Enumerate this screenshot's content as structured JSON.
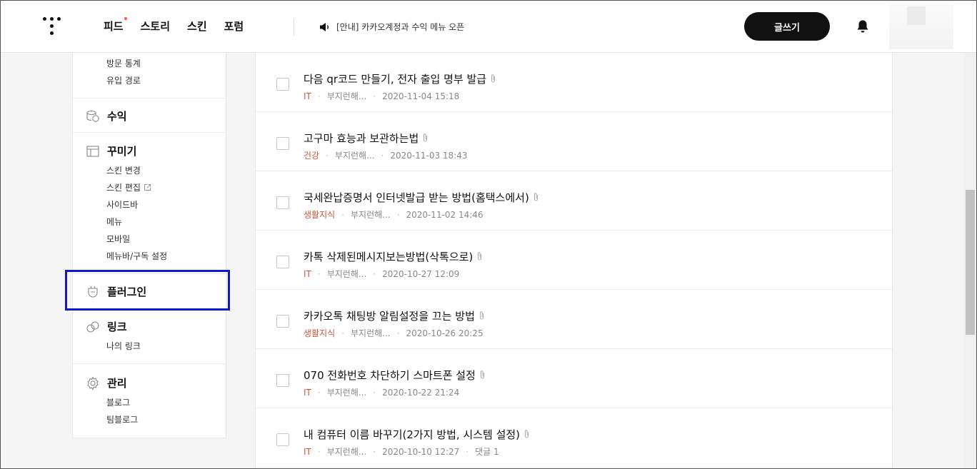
{
  "header": {
    "nav": [
      {
        "label": "피드",
        "new": true
      },
      {
        "label": "스토리",
        "new": false
      },
      {
        "label": "스킨",
        "new": false
      },
      {
        "label": "포럼",
        "new": false
      }
    ],
    "notice": "[안내] 카카오계정과 수익 메뉴 오픈",
    "write_label": "글쓰기"
  },
  "sidebar": {
    "stats_subs": [
      "방문 통계",
      "유입 경로"
    ],
    "revenue": "수익",
    "decorate": {
      "label": "꾸미기",
      "subs": [
        "스킨 변경",
        "스킨 편집",
        "사이드바",
        "메뉴",
        "모바일",
        "메뉴바/구독 설정"
      ]
    },
    "plugin": "플러그인",
    "link": {
      "label": "링크",
      "subs": [
        "나의 링크"
      ]
    },
    "manage": {
      "label": "관리",
      "subs": [
        "블로그",
        "팀블로그"
      ]
    }
  },
  "posts": [
    {
      "title": "다음 qr코드 만들기, 전자 출입 명부 발급",
      "category": "IT",
      "author": "부지런해...",
      "date": "2020-11-04 15:18",
      "comments": ""
    },
    {
      "title": "고구마 효능과 보관하는법",
      "category": "건강",
      "author": "부지런해...",
      "date": "2020-11-03 18:43",
      "comments": ""
    },
    {
      "title": "국세완납증명서 인터넷발급 받는 방법(홈택스에서)",
      "category": "생활지식",
      "author": "부지런해...",
      "date": "2020-11-02 14:46",
      "comments": ""
    },
    {
      "title": "카톡 삭제된메시지보는방법(삭톡으로)",
      "category": "IT",
      "author": "부지런해...",
      "date": "2020-10-27 12:09",
      "comments": ""
    },
    {
      "title": "카카오톡 채팅방 알림설정을 끄는 방법",
      "category": "생활지식",
      "author": "부지런해...",
      "date": "2020-10-26 20:25",
      "comments": ""
    },
    {
      "title": "070 전화번호 차단하기 스마트폰 설정",
      "category": "IT",
      "author": "부지런해...",
      "date": "2020-10-22 21:24",
      "comments": ""
    },
    {
      "title": "내 컴퓨터 이름 바꾸기(2가지 방법, 시스템 설정)",
      "category": "IT",
      "author": "부지런해...",
      "date": "2020-10-10 12:27",
      "comments": "댓글 1"
    }
  ],
  "colors": {
    "accent": "#111111",
    "category": "#d0583a",
    "highlight": "#1018c8"
  }
}
